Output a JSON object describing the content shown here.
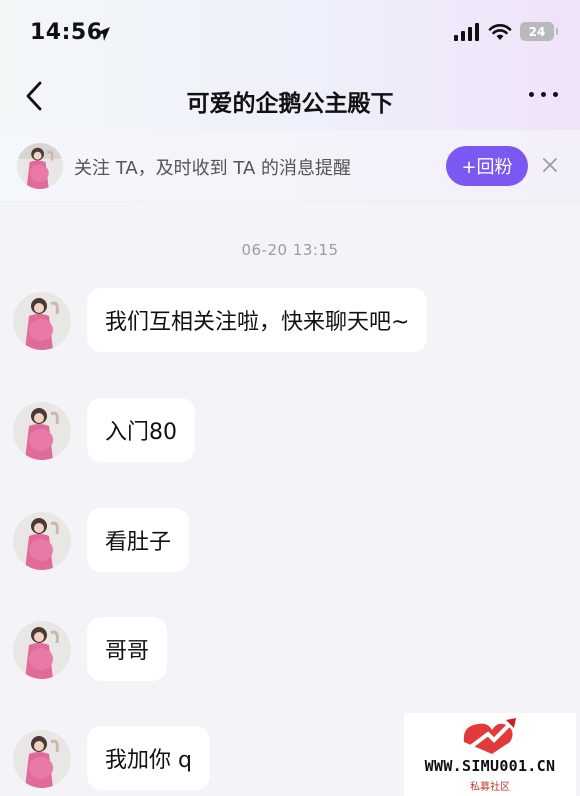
{
  "status_bar": {
    "time": "14:56",
    "battery_level": "24"
  },
  "nav": {
    "title": "可爱的企鹅公主殿下"
  },
  "follow_bar": {
    "text": "关注 TA，及时收到 TA 的消息提醒",
    "button_label": "+回粉"
  },
  "chat": {
    "timestamp": "06-20  13:15",
    "messages": [
      {
        "text": "我们互相关注啦，快来聊天吧~"
      },
      {
        "text": "入门80"
      },
      {
        "text": "看肚子"
      },
      {
        "text": "哥哥"
      },
      {
        "text": "我加你 q"
      }
    ]
  },
  "watermark": {
    "site": "WWW.SIMU001.CN",
    "subtitle": "私募社区"
  },
  "colors": {
    "accent": "#7b58f2",
    "avatar_dress": "#e06a9a",
    "bubble": "#ffffff",
    "background": "#f4f3f8"
  }
}
